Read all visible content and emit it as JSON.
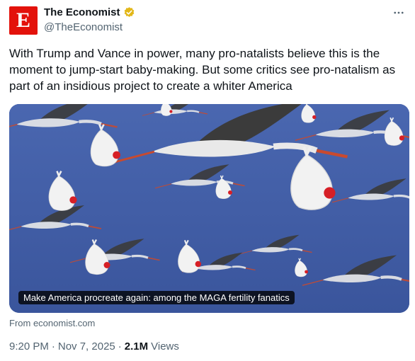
{
  "author": {
    "avatar_letter": "E",
    "display_name": "The Economist",
    "handle": "@TheEconomist",
    "brand_color": "#e3120b",
    "verified_badge_color": "#e2b719"
  },
  "tweet": {
    "text": "With Trump and Vance in power, many pro-natalists believe this is the moment to jump-start baby-making. But some critics see pro-natalism as part of an insidious project to create a whiter America"
  },
  "link_card": {
    "caption": "Make America procreate again: among the MAGA fertility fanatics",
    "source": "From economist.com",
    "image_description_icon": "storks-carrying-babies-illustration"
  },
  "meta": {
    "time": "9:20 PM",
    "separator": "·",
    "date": "Nov 7, 2025",
    "views_count": "2.1M",
    "views_label": "Views"
  },
  "colors": {
    "sky": "#3d5aa3",
    "bundle": "#f2f2f2",
    "hat": "#d61f26",
    "text_secondary": "#536471"
  }
}
